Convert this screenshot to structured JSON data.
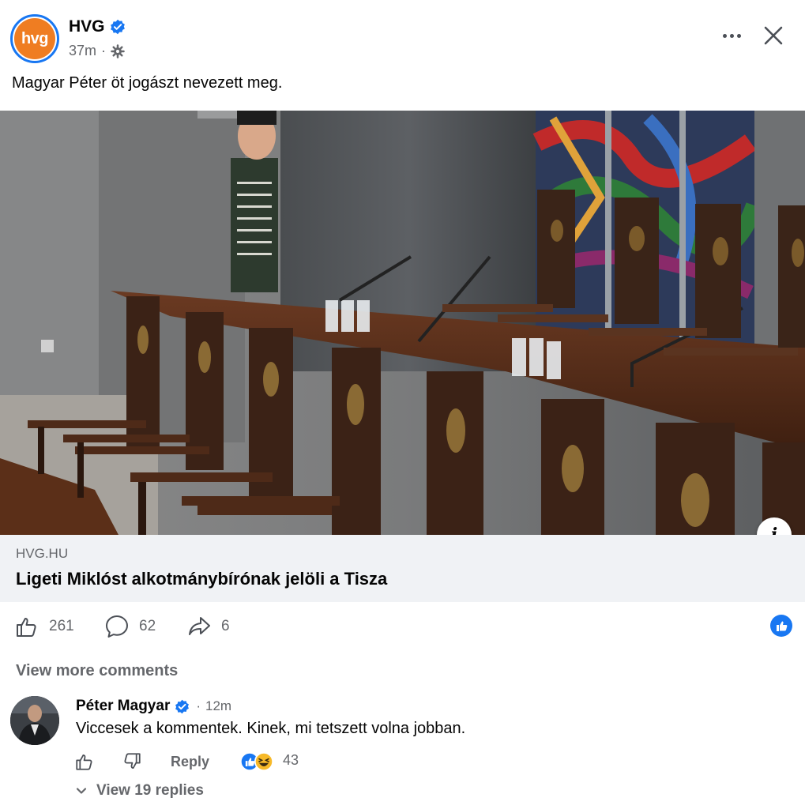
{
  "post": {
    "author": "HVG",
    "avatar_text": "hvg",
    "time": "37m",
    "separator": "·",
    "text": "Magyar Péter öt jogászt nevezett meg."
  },
  "link": {
    "domain": "HVG.HU",
    "title": "Ligeti Miklóst alkotmánybírónak jelöli a Tisza"
  },
  "stats": {
    "likes": "261",
    "comments": "62",
    "shares": "6"
  },
  "comments_section": {
    "view_more": "View more comments"
  },
  "comment": {
    "author": "Péter Magyar",
    "separator": "·",
    "time": "12m",
    "text": "Viccesek a kommentek. Kinek, mi tetszett volna jobban.",
    "reply_label": "Reply",
    "reaction_count": "43",
    "view_replies": "View 19 replies"
  },
  "colors": {
    "brand_orange": "#ef7d22",
    "facebook_blue": "#1877f2",
    "secondary_text": "#65676b",
    "link_background": "#f0f2f5"
  },
  "icons": [
    "verified-badge-icon",
    "globe-gear-icon",
    "more-icon",
    "close-icon",
    "info-icon",
    "like-icon",
    "comment-icon",
    "share-icon",
    "like-reaction-icon",
    "dislike-icon",
    "haha-reaction-icon",
    "chevron-down-icon"
  ]
}
